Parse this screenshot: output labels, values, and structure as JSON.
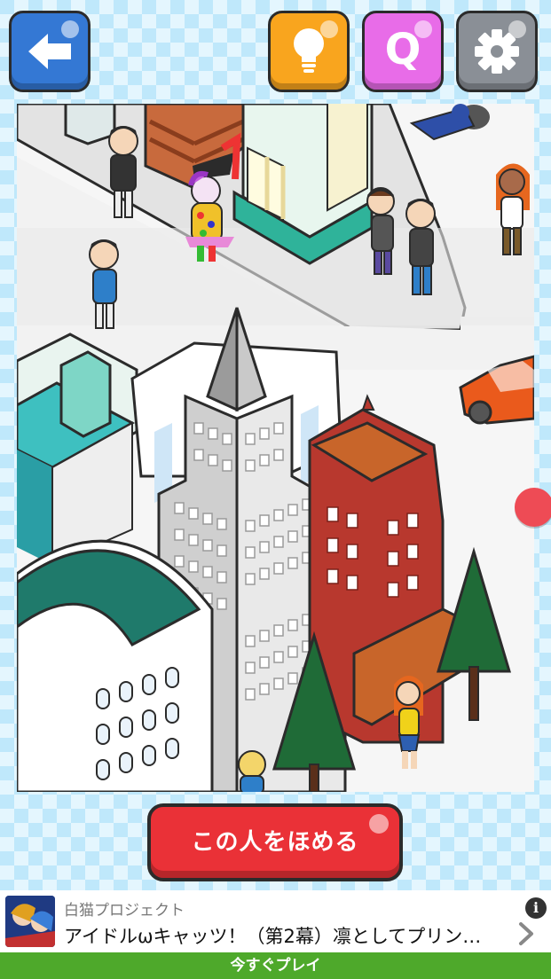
{
  "toolbar": {
    "back_icon": "left-arrow-icon",
    "hint_icon": "lightbulb-icon",
    "quiz_letter": "Q",
    "settings_icon": "gear-icon",
    "colors": {
      "back": "#3478d4",
      "hint": "#f9a51e",
      "quiz": "#e86ce8",
      "settings": "#8a8f96"
    }
  },
  "main": {
    "praise_button": "この人をほめる",
    "scene_icon": "isometric-city-scene",
    "side_scroll_icon": "red-circle-icon"
  },
  "ad": {
    "source": "白猫プロジェクト",
    "title": "アイドルωキャッツ！（第2幕）凛としてプリン…",
    "info_icon": "i",
    "cta": "今すぐプレイ",
    "cta_color": "#4ea92b"
  }
}
